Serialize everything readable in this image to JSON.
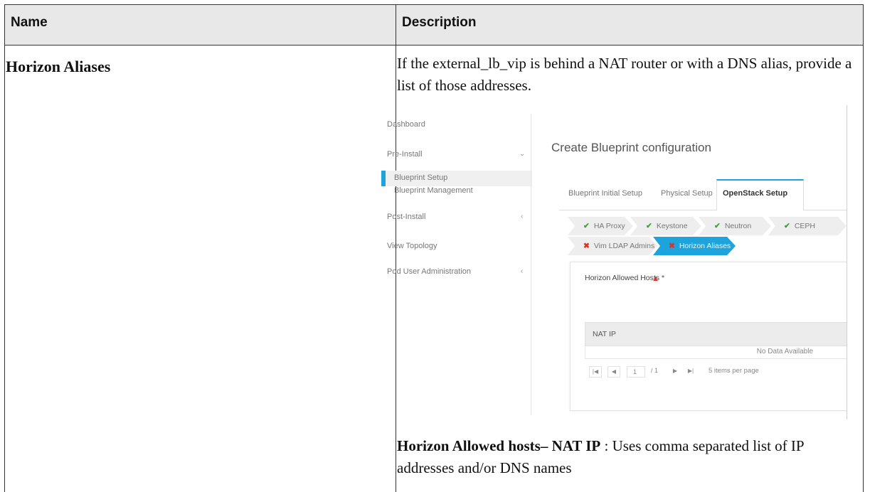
{
  "table": {
    "headers": {
      "name": "Name",
      "description": "Description"
    },
    "row": {
      "name": "Horizon Aliases",
      "description": "If the external_lb_vip is behind a NAT router or with a DNS alias, provide a list of those addresses.",
      "footer_bold": "Horizon Allowed hosts– NAT IP",
      "footer_rest": " : Uses comma separated list of IP addresses and/or DNS names"
    }
  },
  "screenshot": {
    "sidebar": {
      "items": [
        {
          "label": "Dashboard"
        },
        {
          "label": "Pre-Install",
          "caret": "⌄"
        },
        {
          "label": "Blueprint Setup"
        },
        {
          "label": "Blueprint Management"
        },
        {
          "label": "Post-Install",
          "caret": "‹"
        },
        {
          "label": "View Topology"
        },
        {
          "label": "Pod User Administration",
          "caret": "‹"
        }
      ]
    },
    "title": "Create Blueprint configuration",
    "tabs": [
      "Blueprint Initial Setup",
      "Physical Setup",
      "OpenStack Setup"
    ],
    "steps": [
      {
        "label": "HA Proxy",
        "status": "done"
      },
      {
        "label": "Keystone",
        "status": "done"
      },
      {
        "label": "Neutron",
        "status": "done"
      },
      {
        "label": "CEPH",
        "status": "done"
      },
      {
        "label": "Vim LDAP Admins",
        "status": "error"
      },
      {
        "label": "Horizon Aliases",
        "status": "error"
      }
    ],
    "form": {
      "label": "Horizon Allowed Hosts *",
      "column_header": "NAT IP",
      "empty_text": "No Data Available",
      "pager": {
        "page": "1",
        "total": "/ 1",
        "page_size_label": "5 items per page"
      }
    },
    "colors": {
      "accent": "#1ea4dc",
      "check": "#3aa03a",
      "error": "#d9352a"
    }
  }
}
